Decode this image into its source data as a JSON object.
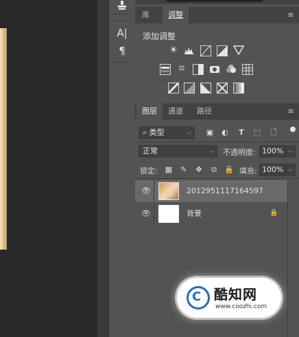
{
  "panels": {
    "top_tabs": [
      "库",
      "调整"
    ],
    "adjustments": {
      "title": "添加调整",
      "row1_icons": [
        "brightness-contrast-icon",
        "levels-icon",
        "curves-icon",
        "exposure-icon",
        "vibrance-icon"
      ],
      "row2_icons": [
        "hue-saturation-icon",
        "color-balance-icon",
        "black-white-icon",
        "photo-filter-icon",
        "channel-mixer-icon",
        "color-lookup-icon"
      ],
      "row3_icons": [
        "invert-icon",
        "posterize-icon",
        "threshold-icon",
        "selective-color-icon",
        "gradient-map-icon"
      ]
    },
    "layers_tabs": [
      "图层",
      "通道",
      "路径"
    ],
    "filter": {
      "kind_label": "类型"
    },
    "blend_mode": "正常",
    "opacity": {
      "label": "不透明度:",
      "value": "100%"
    },
    "lock": {
      "label": "锁定:"
    },
    "fill": {
      "label": "填充:",
      "value": "100%"
    },
    "layers": [
      {
        "name": "2012951117164597",
        "selected": true
      },
      {
        "name": "背景",
        "locked": true
      }
    ]
  },
  "tools": {
    "items": [
      "stamp-tool-icon",
      "character-panel-icon",
      "paragraph-panel-icon"
    ],
    "labels": [
      "A|",
      "¶"
    ]
  },
  "watermark": {
    "brand": "酷知网",
    "url": "www.coozhi.com",
    "logo_letter": "C"
  },
  "colors": {
    "panel_bg": "#535353",
    "tab_bg": "#424242",
    "canvas_bg": "#282828",
    "selected_row": "#696969",
    "watermark_blue": "#1d6fb8"
  }
}
